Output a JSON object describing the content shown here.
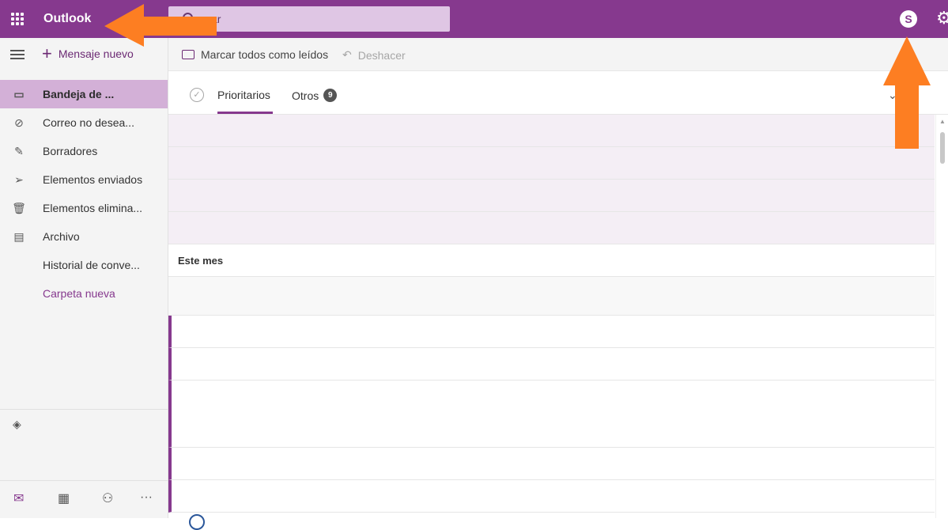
{
  "header": {
    "app_name": "Outlook",
    "search_placeholder": "Buscar",
    "search_visible_text": "scar"
  },
  "sidebar": {
    "new_message": "Mensaje nuevo",
    "folders": [
      {
        "label": "Bandeja de ...",
        "icon": "inbox-icon",
        "selected": true
      },
      {
        "label": "Correo no desea...",
        "icon": "block-icon"
      },
      {
        "label": "Borradores",
        "icon": "pencil-icon"
      },
      {
        "label": "Elementos enviados",
        "icon": "send-icon"
      },
      {
        "label": "Elementos elimina...",
        "icon": "trash-icon"
      },
      {
        "label": "Archivo",
        "icon": "archive-icon"
      },
      {
        "label": "Historial de conve...",
        "icon": ""
      },
      {
        "label": "Carpeta nueva",
        "icon": ""
      }
    ],
    "bottom_nav": [
      "mail-icon",
      "calendar-icon",
      "people-icon",
      "more-icon"
    ]
  },
  "toolbar": {
    "mark_all_read": "Marcar todos como leídos",
    "undo": "Deshacer"
  },
  "tabs": {
    "focused": "Prioritarios",
    "other": "Otros",
    "other_count": "9"
  },
  "list": {
    "section_this_month": "Este mes"
  },
  "colors": {
    "brand": "#86398e",
    "selected_folder": "#d3b0d7",
    "search_bg": "#dfc6e4",
    "arrow_annotation": "#fd7e22"
  }
}
